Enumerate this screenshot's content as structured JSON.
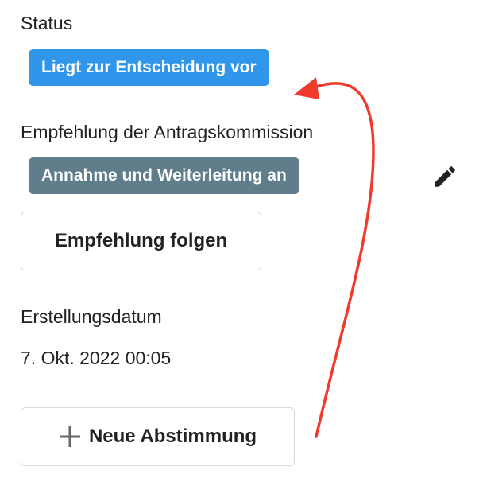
{
  "status": {
    "label": "Status",
    "badge": "Liegt zur Entscheidung vor",
    "badge_color": "#2f96eb"
  },
  "recommendation": {
    "label": "Empfehlung der Antragskommission",
    "badge": "Annahme und Weiterleitung an",
    "badge_color": "#607d8b",
    "edit_icon": "pencil-icon",
    "follow_button": "Empfehlung folgen"
  },
  "created": {
    "label": "Erstellungsdatum",
    "value": "7. Okt. 2022 00:05"
  },
  "new_vote_button": {
    "label": "Neue Abstimmung",
    "icon": "plus-icon"
  },
  "annotation": {
    "arrow_color": "#f03a2e"
  }
}
